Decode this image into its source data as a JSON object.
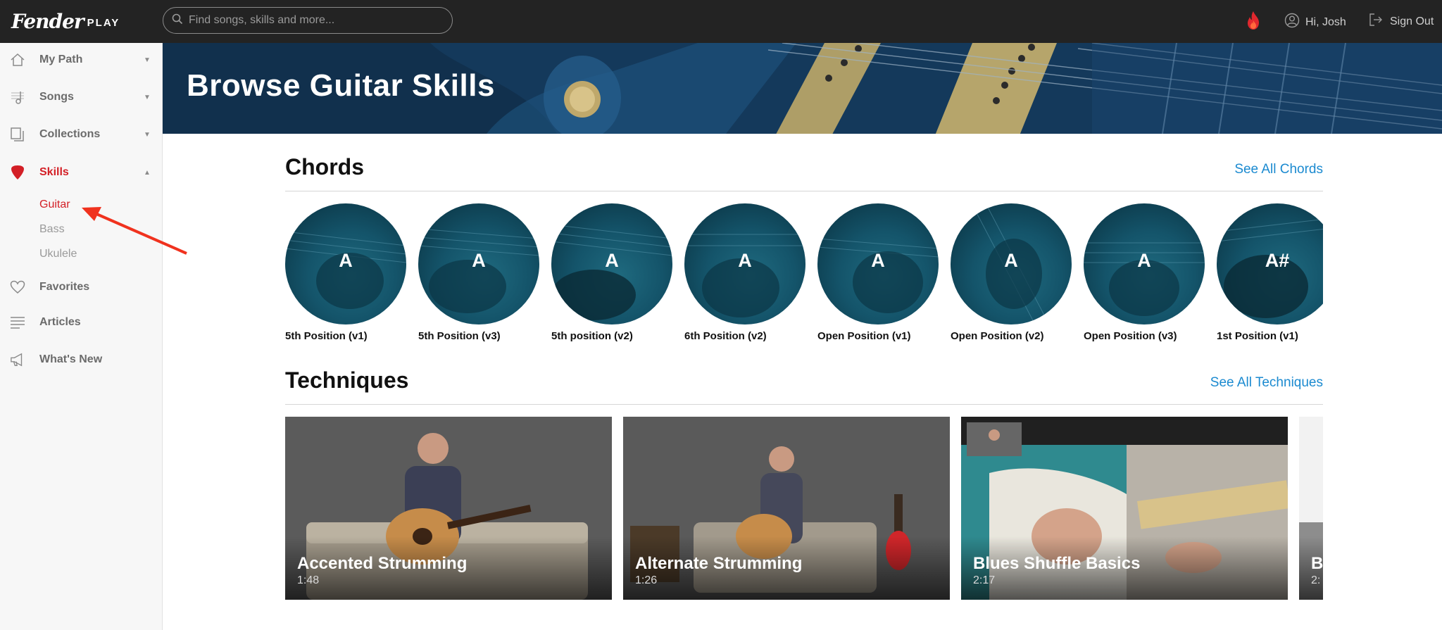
{
  "topbar": {
    "logo_brand": "Fender",
    "logo_product": "PLAY",
    "search_placeholder": "Find songs, skills and more...",
    "greeting": "Hi, Josh",
    "signout": "Sign Out"
  },
  "sidebar": {
    "items": [
      {
        "label": "My Path",
        "icon": "home-icon"
      },
      {
        "label": "Songs",
        "icon": "music-note-icon"
      },
      {
        "label": "Collections",
        "icon": "collections-icon"
      },
      {
        "label": "Skills",
        "icon": "guitar-pick-icon"
      },
      {
        "label": "Favorites",
        "icon": "heart-icon"
      },
      {
        "label": "Articles",
        "icon": "articles-icon"
      },
      {
        "label": "What's New",
        "icon": "megaphone-icon"
      }
    ],
    "sub_items": [
      {
        "label": "Guitar"
      },
      {
        "label": "Bass"
      },
      {
        "label": "Ukulele"
      }
    ]
  },
  "hero": {
    "title": "Browse Guitar Skills"
  },
  "chords_section": {
    "title": "Chords",
    "see_all": "See All Chords",
    "items": [
      {
        "chord": "A",
        "caption": "5th Position (v1)"
      },
      {
        "chord": "A",
        "caption": "5th Position (v3)"
      },
      {
        "chord": "A",
        "caption": "5th position (v2)"
      },
      {
        "chord": "A",
        "caption": "6th Position (v2)"
      },
      {
        "chord": "A",
        "caption": "Open Position (v1)"
      },
      {
        "chord": "A",
        "caption": "Open Position (v2)"
      },
      {
        "chord": "A",
        "caption": "Open Position (v3)"
      },
      {
        "chord": "A#",
        "caption": "1st Position (v1)"
      }
    ]
  },
  "techniques_section": {
    "title": "Techniques",
    "see_all": "See All Techniques",
    "items": [
      {
        "title": "Accented Strumming",
        "duration": "1:48"
      },
      {
        "title": "Alternate Strumming",
        "duration": "1:26"
      },
      {
        "title": "Blues Shuffle Basics",
        "duration": "2:17"
      },
      {
        "title": "B",
        "duration": "2:"
      }
    ]
  },
  "colors": {
    "accent_red": "#d31f26",
    "link_blue": "#1b8ad0",
    "topbar_bg": "#232323",
    "sidebar_bg": "#f7f7f7"
  }
}
